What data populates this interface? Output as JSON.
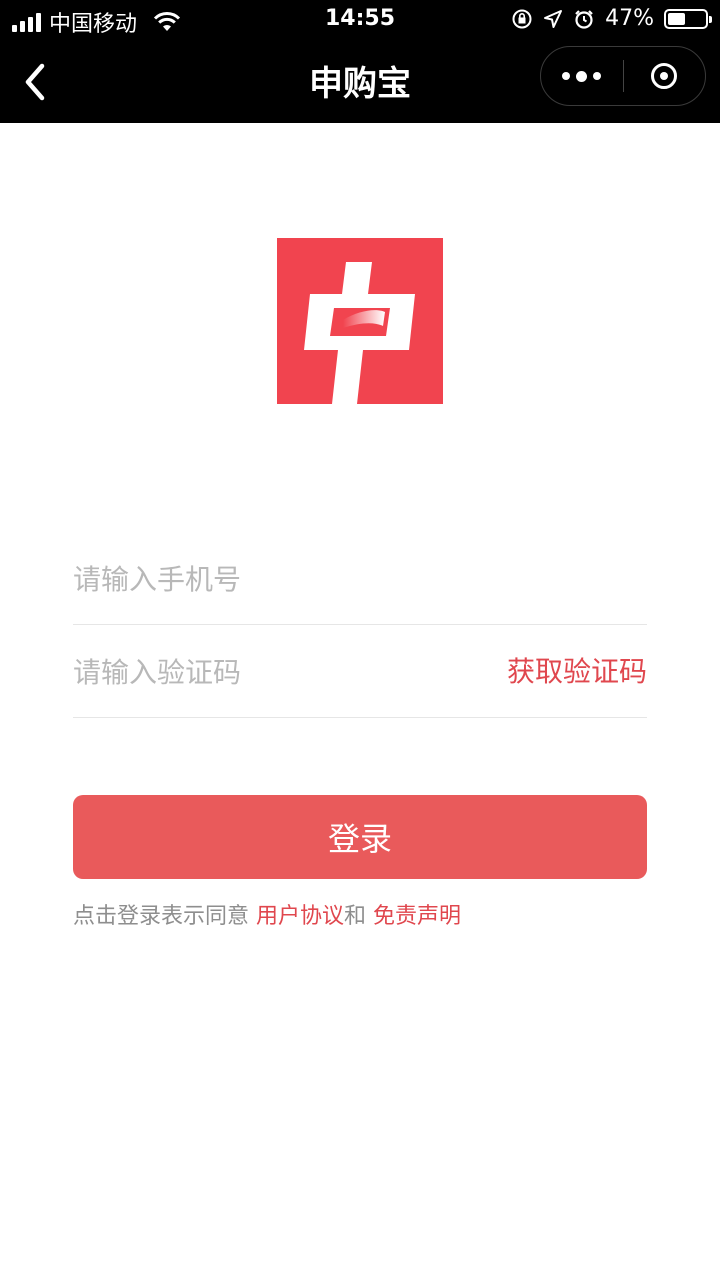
{
  "status_bar": {
    "carrier": "中国移动",
    "time": "14:55",
    "battery_text": "47%",
    "battery_level": 0.47,
    "icons": [
      "signal-icon",
      "wifi-icon",
      "rotation-lock-icon",
      "location-icon",
      "alarm-icon",
      "battery-icon"
    ]
  },
  "nav": {
    "title": "申购宝",
    "back_icon": "chevron-left-icon",
    "more_icon": "more-dots-icon",
    "home_icon": "target-icon"
  },
  "logo": {
    "char": "申",
    "bg_color": "#f1444f"
  },
  "form": {
    "phone_placeholder": "请输入手机号",
    "code_placeholder": "请输入验证码",
    "get_code_label": "获取验证码",
    "login_label": "登录"
  },
  "agreement": {
    "prefix": "点击登录表示同意 ",
    "user_agreement": "用户协议",
    "and": "和 ",
    "disclaimer": "免责声明"
  },
  "colors": {
    "accent": "#e0474e",
    "button": "#e95a5b",
    "topbar": "#000000"
  }
}
